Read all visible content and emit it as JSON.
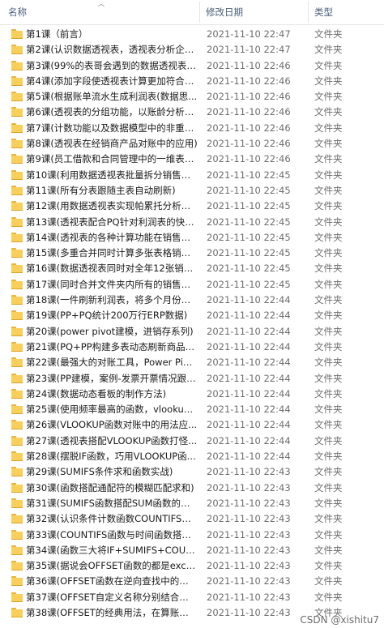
{
  "columns": {
    "name": "名称",
    "date": "修改日期",
    "type": "类型"
  },
  "icons": {
    "sort": "sort-up-arrow-icon",
    "row": "folder-icon"
  },
  "files": [
    {
      "name": "第1课（前言）",
      "date": "2021-11-10 22:47",
      "type": "文件夹"
    },
    {
      "name": "第2课(认识数据透视表，透视表分析企业...",
      "date": "2021-11-10 22:47",
      "type": "文件夹"
    },
    {
      "name": "第3课(99%的表哥会遇到的数据透视表问...",
      "date": "2021-11-10 22:46",
      "type": "文件夹"
    },
    {
      "name": "第4课(添加字段使透视表计算更加符合业...",
      "date": "2021-11-10 22:46",
      "type": "文件夹"
    },
    {
      "name": "第5课(根据账单流水生成利润表(数据思...",
      "date": "2021-11-10 22:46",
      "type": "文件夹"
    },
    {
      "name": "第6课(透视表的分组功能，以账龄分析为...",
      "date": "2021-11-10 22:46",
      "type": "文件夹"
    },
    {
      "name": "第7课(计数功能以及数据模型中的非重复...",
      "date": "2021-11-10 22:46",
      "type": "文件夹"
    },
    {
      "name": "第8课(透视表在经销商产品对账中的应用)",
      "date": "2021-11-10 22:46",
      "type": "文件夹"
    },
    {
      "name": "第9课(员工借款和合同管理中的一维表、...",
      "date": "2021-11-10 22:46",
      "type": "文件夹"
    },
    {
      "name": "第10课(利用数据透视表批量拆分销售总表)",
      "date": "2021-11-10 22:45",
      "type": "文件夹"
    },
    {
      "name": "第11课(所有分表跟随主表自动刷新)",
      "date": "2021-11-10 22:45",
      "type": "文件夹"
    },
    {
      "name": "第12课(用数据透视表实现帕累托分析。...",
      "date": "2021-11-10 22:45",
      "type": "文件夹"
    },
    {
      "name": "第13课(透视表配合PQ针对利润表的快速...",
      "date": "2021-11-10 22:45",
      "type": "文件夹"
    },
    {
      "name": "第14课(透视表的各种计算功能在销售明...",
      "date": "2021-11-10 22:45",
      "type": "文件夹"
    },
    {
      "name": "第15课(多重合并同时计算多张表格销售...",
      "date": "2021-11-10 22:45",
      "type": "文件夹"
    },
    {
      "name": "第16课(数据透视表同时对全年12张销售...",
      "date": "2021-11-10 22:45",
      "type": "文件夹"
    },
    {
      "name": "第17课(同时合并文件夹内所有的销售数...",
      "date": "2021-11-10 22:45",
      "type": "文件夹"
    },
    {
      "name": "第18课(一件刷新利润表，将多个月份的...",
      "date": "2021-11-10 22:44",
      "type": "文件夹"
    },
    {
      "name": "第19课(PP+PQ统计200万行ERP数据)",
      "date": "2021-11-10 22:44",
      "type": "文件夹"
    },
    {
      "name": "第20课(power pivot建模，进销存系列)",
      "date": "2021-11-10 22:44",
      "type": "文件夹"
    },
    {
      "name": "第21课(PQ+PP构建多表动态刷新商品销...",
      "date": "2021-11-10 22:44",
      "type": "文件夹"
    },
    {
      "name": "第22课(最强大的对账工具，Power Pivo...",
      "date": "2021-11-10 22:44",
      "type": "文件夹"
    },
    {
      "name": "第23课(PP建模，案例-发票开票情况跟踪...",
      "date": "2021-11-10 22:44",
      "type": "文件夹"
    },
    {
      "name": "第24课(数据动态看板的制作方法)",
      "date": "2021-11-10 22:44",
      "type": "文件夹"
    },
    {
      "name": "第25课(使用频率最高的函数，vlookup...",
      "date": "2021-11-10 22:44",
      "type": "文件夹"
    },
    {
      "name": "第26课(VLOOKUP函数对账中的用法应...",
      "date": "2021-11-10 22:44",
      "type": "文件夹"
    },
    {
      "name": "第27课(透视表搭配VLOOKUP函数打怪...",
      "date": "2021-11-10 22:44",
      "type": "文件夹"
    },
    {
      "name": "第28课(摆脱IF函数，巧用VLOOKUP函...",
      "date": "2021-11-10 22:44",
      "type": "文件夹"
    },
    {
      "name": "第29课(SUMIFS条件求和函数实战)",
      "date": "2021-11-10 22:43",
      "type": "文件夹"
    },
    {
      "name": "第30课(函数搭配通配符的模糊匹配求和)",
      "date": "2021-11-10 22:43",
      "type": "文件夹"
    },
    {
      "name": "第31课(SUMIFS函数搭配SUM函数的多...",
      "date": "2021-11-10 22:43",
      "type": "文件夹"
    },
    {
      "name": "第32课(认识条件计数函数COUNTIFS函...",
      "date": "2021-11-10 22:43",
      "type": "文件夹"
    },
    {
      "name": "第33课(COUNTIFS函数与时间函数搭配...",
      "date": "2021-11-10 22:43",
      "type": "文件夹"
    },
    {
      "name": "第34课(函数三大将IF+SUMIFS+COUN...",
      "date": "2021-11-10 22:43",
      "type": "文件夹"
    },
    {
      "name": "第35课(据说会OFFSET函数的都是excel...",
      "date": "2021-11-10 22:43",
      "type": "文件夹"
    },
    {
      "name": "第36课(OFFSET函数在逆向查找中的妙用)",
      "date": "2021-11-10 22:43",
      "type": "文件夹"
    },
    {
      "name": "第37课(OFFSET自定义名称分别结合数据...",
      "date": "2021-11-10 22:43",
      "type": "文件夹"
    },
    {
      "name": "第38课(OFFSET的经典用法，在算账龄超...",
      "date": "2021-11-10 22:43",
      "type": "文件夹"
    }
  ],
  "watermark": "CSDN @xishitu7"
}
